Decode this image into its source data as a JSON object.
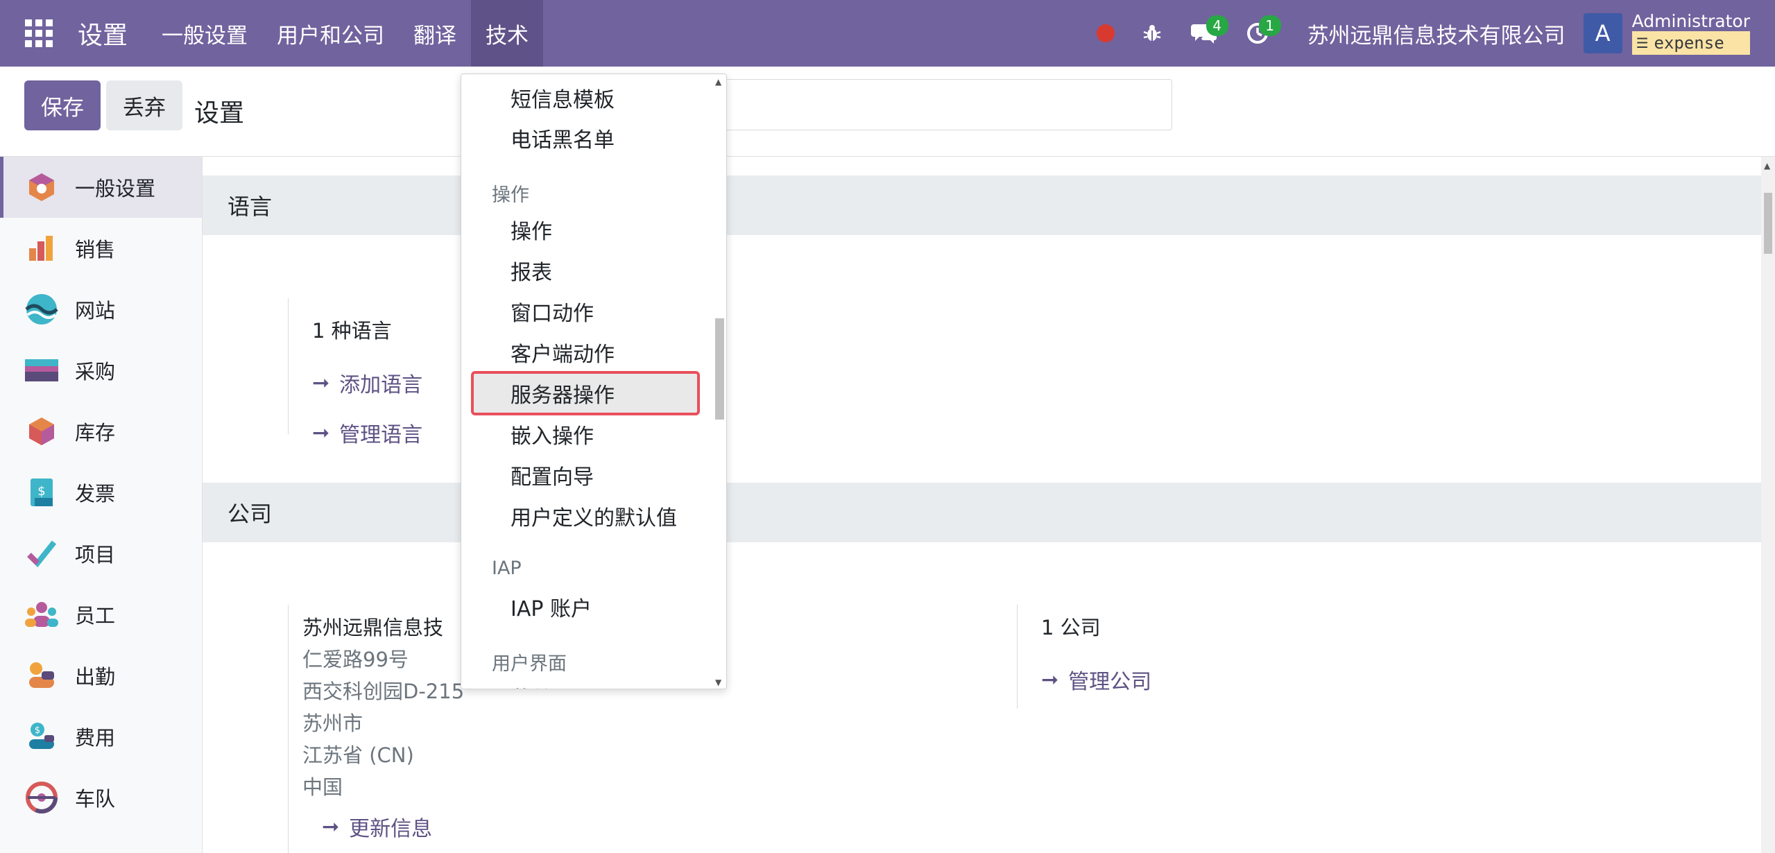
{
  "navbar": {
    "brand": "设置",
    "menu": [
      "一般设置",
      "用户和公司",
      "翻译",
      "技术"
    ],
    "active_menu": "技术",
    "messages_count": "4",
    "activities_count": "1",
    "company": "苏州远鼎信息技术有限公司",
    "avatar_letter": "A",
    "user_name": "Administrator",
    "database": "expense",
    "colors": {
      "navbar": "#71639e",
      "status_dot": "#d93a2f",
      "badge": "#28a745",
      "db_badge": "#fbe3a5"
    }
  },
  "control_panel": {
    "save_label": "保存",
    "discard_label": "丢弃",
    "title": "设置",
    "search_placeholder": ""
  },
  "sidebar": {
    "items": [
      {
        "label": "一般设置",
        "icon": "settings-app-icon"
      },
      {
        "label": "销售",
        "icon": "sales-app-icon"
      },
      {
        "label": "网站",
        "icon": "website-app-icon"
      },
      {
        "label": "采购",
        "icon": "purchase-app-icon"
      },
      {
        "label": "库存",
        "icon": "inventory-app-icon"
      },
      {
        "label": "发票",
        "icon": "invoicing-app-icon"
      },
      {
        "label": "项目",
        "icon": "project-app-icon"
      },
      {
        "label": "员工",
        "icon": "employees-app-icon"
      },
      {
        "label": "出勤",
        "icon": "attendance-app-icon"
      },
      {
        "label": "费用",
        "icon": "expenses-app-icon"
      },
      {
        "label": "车队",
        "icon": "fleet-app-icon"
      }
    ]
  },
  "main": {
    "language_section": {
      "title": "语言",
      "count_text": "1 种语言",
      "add_link": "添加语言",
      "manage_link": "管理语言"
    },
    "company_section": {
      "title": "公司",
      "company_name": "苏州远鼎信息技",
      "address": [
        "仁爱路99号",
        "西交科创园D-215",
        "苏州市",
        "江苏省 (CN)",
        "中国"
      ],
      "update_link": "更新信息",
      "companies_count": "1 公司",
      "manage_companies_link": "管理公司"
    }
  },
  "dropdown": {
    "items_top": [
      "短信息模板",
      "电话黑名单"
    ],
    "group_actions": "操作",
    "actions": [
      "操作",
      "报表",
      "窗口动作",
      "客户端动作",
      "服务器操作",
      "嵌入操作",
      "配置向导",
      "用户定义的默认值"
    ],
    "highlighted": "服务器操作",
    "group_iap": "IAP",
    "iap_items": [
      "IAP 账户"
    ],
    "group_ui": "用户界面",
    "ui_partial": "菜单项"
  }
}
